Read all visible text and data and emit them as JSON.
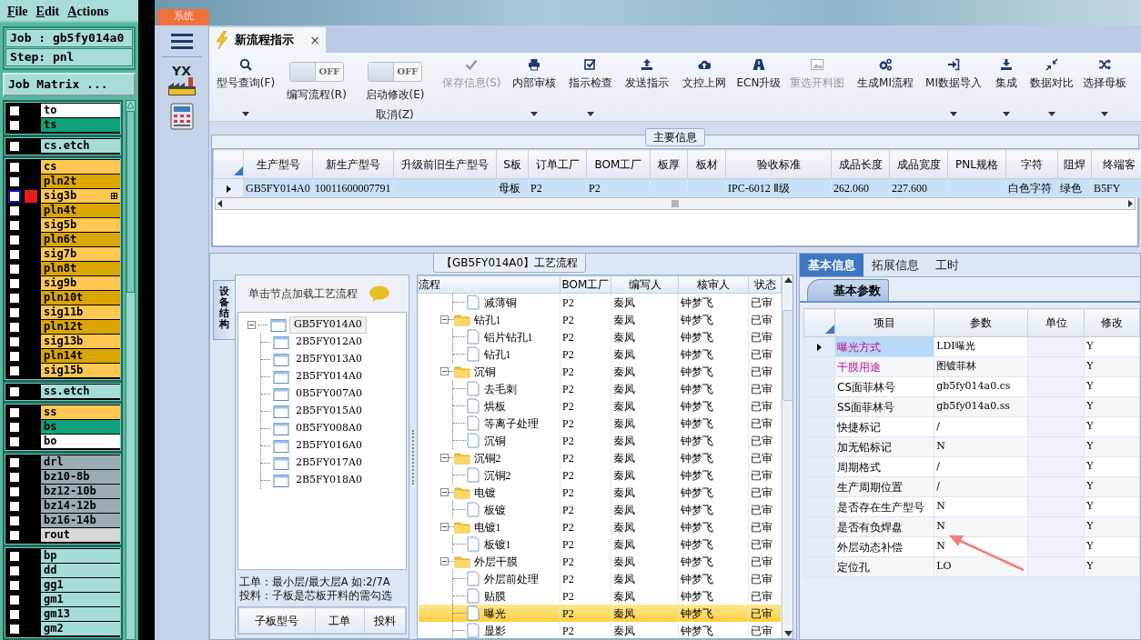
{
  "left_panel": {
    "menu": [
      "File",
      "Edit",
      "Actions"
    ],
    "job": "Job : gb5fy014a0",
    "step": "Step: pnl",
    "matrix_button": "Job Matrix ...",
    "layer_groups": [
      {
        "layers": [
          {
            "name": "to",
            "color": "#ffffff",
            "checked": false,
            "selected": false
          },
          {
            "name": "ts",
            "color": "#10a07a",
            "checked": false,
            "selected": false
          }
        ]
      },
      {
        "layers": [
          {
            "name": "cs.etch",
            "color": "#a6dcd8",
            "checked": false,
            "selected": false
          }
        ]
      },
      {
        "layers": [
          {
            "name": "cs",
            "color": "#ffc852",
            "checked": false,
            "selected": false
          },
          {
            "name": "pln2t",
            "color": "#dca600",
            "checked": false,
            "selected": false
          },
          {
            "name": "sig3b",
            "color": "#ffc852",
            "checked": false,
            "selected": true
          },
          {
            "name": "pln4t",
            "color": "#dca600",
            "checked": false,
            "selected": false
          },
          {
            "name": "sig5b",
            "color": "#ffc852",
            "checked": false,
            "selected": false
          },
          {
            "name": "pln6t",
            "color": "#dca600",
            "checked": false,
            "selected": false
          },
          {
            "name": "sig7b",
            "color": "#ffc852",
            "checked": false,
            "selected": false
          },
          {
            "name": "pln8t",
            "color": "#dca600",
            "checked": false,
            "selected": false
          },
          {
            "name": "sig9b",
            "color": "#ffc852",
            "checked": false,
            "selected": false
          },
          {
            "name": "pln10t",
            "color": "#dca600",
            "checked": false,
            "selected": false
          },
          {
            "name": "sig11b",
            "color": "#ffc852",
            "checked": false,
            "selected": false
          },
          {
            "name": "pln12t",
            "color": "#dca600",
            "checked": false,
            "selected": false
          },
          {
            "name": "sig13b",
            "color": "#ffc852",
            "checked": false,
            "selected": false
          },
          {
            "name": "pln14t",
            "color": "#dca600",
            "checked": false,
            "selected": false
          },
          {
            "name": "sig15b",
            "color": "#ffc852",
            "checked": false,
            "selected": false
          }
        ]
      },
      {
        "layers": [
          {
            "name": "ss.etch",
            "color": "#a6dcd8",
            "checked": false,
            "selected": false
          }
        ]
      },
      {
        "layers": [
          {
            "name": "ss",
            "color": "#ffc852",
            "checked": false,
            "selected": false
          },
          {
            "name": "bs",
            "color": "#10a07a",
            "checked": false,
            "selected": false
          },
          {
            "name": "bo",
            "color": "#ffffff",
            "checked": false,
            "selected": false
          }
        ]
      },
      {
        "layers": [
          {
            "name": "drl",
            "color": "#9aacb4",
            "checked": false,
            "selected": false
          },
          {
            "name": "bz10-8b",
            "color": "#9aacb4",
            "checked": false,
            "selected": false
          },
          {
            "name": "bz12-10b",
            "color": "#9aacb4",
            "checked": false,
            "selected": false
          },
          {
            "name": "bz14-12b",
            "color": "#9aacb4",
            "checked": false,
            "selected": false
          },
          {
            "name": "bz16-14b",
            "color": "#9aacb4",
            "checked": false,
            "selected": false
          },
          {
            "name": "rout",
            "color": "#d8d8d8",
            "checked": false,
            "selected": false
          }
        ]
      },
      {
        "layers": [
          {
            "name": "bp",
            "color": "#a6dcd8",
            "checked": false,
            "selected": false
          },
          {
            "name": "dd",
            "color": "#a6dcd8",
            "checked": false,
            "selected": false
          },
          {
            "name": "gg1",
            "color": "#a6dcd8",
            "checked": false,
            "selected": false
          },
          {
            "name": "gm1",
            "color": "#a6dcd8",
            "checked": false,
            "selected": false
          },
          {
            "name": "gm13",
            "color": "#a6dcd8",
            "checked": false,
            "selected": false
          },
          {
            "name": "gm2",
            "color": "#a6dcd8",
            "checked": false,
            "selected": false
          }
        ]
      }
    ]
  },
  "app": {
    "system_tab": "系统",
    "logo_text": "YX",
    "document_tab": {
      "title": "新流程指示",
      "close": "×"
    },
    "toolbar": [
      {
        "kind": "button",
        "label": "型号查询(F)",
        "dropdown": true,
        "disabled": false
      },
      {
        "kind": "toggle",
        "state_text": "OFF",
        "on": false,
        "label": "编写流程(R)"
      },
      {
        "kind": "toggle",
        "state_text": "OFF",
        "on": false,
        "label": "启动修改(E)",
        "label2": "取消(Z)"
      },
      {
        "kind": "button",
        "label": "保存信息(S)",
        "dropdown": false,
        "disabled": true
      },
      {
        "kind": "button",
        "label": "内部审核",
        "dropdown": true,
        "disabled": false
      },
      {
        "kind": "button",
        "label": "指示检查",
        "dropdown": true,
        "disabled": false
      },
      {
        "kind": "button",
        "label": "发送指示",
        "dropdown": false,
        "disabled": false
      },
      {
        "kind": "button",
        "label": "文控上网",
        "dropdown": false,
        "disabled": false
      },
      {
        "kind": "button",
        "label": "ECN升级",
        "dropdown": false,
        "disabled": false
      },
      {
        "kind": "button",
        "label": "重选开料图",
        "dropdown": false,
        "disabled": true
      },
      {
        "kind": "button",
        "label": "生成MI流程",
        "dropdown": false,
        "disabled": false
      },
      {
        "kind": "button",
        "label": "MI数据导入",
        "dropdown": true,
        "disabled": false
      },
      {
        "kind": "button",
        "label": "集成",
        "dropdown": true,
        "disabled": false
      },
      {
        "kind": "button",
        "label": "数据对比",
        "dropdown": true,
        "disabled": false
      },
      {
        "kind": "button",
        "label": "选择母板",
        "dropdown": true,
        "disabled": false
      }
    ],
    "main_info": {
      "title": "主要信息",
      "columns": [
        "生产型号",
        "新生产型号",
        "升级前旧生产型号",
        "S板",
        "订单工厂",
        "BOM工厂",
        "板厚",
        "板材",
        "验收标准",
        "成品长度",
        "成品宽度",
        "PNL规格",
        "字符",
        "阻焊",
        "终端客"
      ],
      "rows": [
        {
          "selected": true,
          "cells": [
            "GB5FY014A0",
            "10011600007791",
            null,
            "母板",
            "P2",
            "P2",
            null,
            null,
            "IPC-6012 Ⅱ级",
            "262.060",
            "227.600",
            null,
            "白色字符",
            "绿色",
            "B5FY"
          ]
        }
      ]
    },
    "process": {
      "title": "【GB5FY014A0】工艺流程",
      "side_tab": "设备结构",
      "hint": "单击节点加载工艺流程",
      "tree": {
        "label": "GB5FY014A0",
        "expanded": true,
        "selected": true,
        "children": [
          {
            "label": "2B5FY012A0",
            "selected": false
          },
          {
            "label": "2B5FY013A0",
            "selected": false
          },
          {
            "label": "2B5FY014A0",
            "selected": false
          },
          {
            "label": "0B5FY007A0",
            "selected": false
          },
          {
            "label": "2B5FY015A0",
            "selected": false
          },
          {
            "label": "0B5FY008A0",
            "selected": false
          },
          {
            "label": "2B5FY016A0",
            "selected": false
          },
          {
            "label": "2B5FY017A0",
            "selected": false
          },
          {
            "label": "2B5FY018A0",
            "selected": false
          }
        ]
      },
      "notes": [
        "工单：最小层/最大层A 如:2/7A",
        "投料：子板是芯板开料的需勾选"
      ],
      "sub_columns": [
        "子板型号",
        "工单",
        "投料"
      ],
      "flow_columns": [
        "流程",
        "BOM工厂",
        "编写人",
        "核审人",
        "状态"
      ],
      "flow": [
        {
          "kind": "step",
          "name": "减薄铜",
          "bom": "P2",
          "writer": "秦凤",
          "reviewer": "钟梦飞",
          "status": "已审",
          "selected": false
        },
        {
          "kind": "group",
          "name": "钻孔1",
          "expanded": true,
          "bom": "P2",
          "writer": "秦凤",
          "reviewer": "钟梦飞",
          "status": "已审",
          "selected": false,
          "children": [
            {
              "kind": "step",
              "name": "铝片钻孔1",
              "bom": "P2",
              "writer": "秦凤",
              "reviewer": "钟梦飞",
              "status": "已审",
              "selected": false
            },
            {
              "kind": "step",
              "name": "钻孔1",
              "bom": "P2",
              "writer": "秦凤",
              "reviewer": "钟梦飞",
              "status": "已审",
              "selected": false
            }
          ]
        },
        {
          "kind": "group",
          "name": "沉铜",
          "expanded": true,
          "bom": "P2",
          "writer": "秦凤",
          "reviewer": "钟梦飞",
          "status": "已审",
          "selected": false,
          "children": [
            {
              "kind": "step",
              "name": "去毛刺",
              "bom": "P2",
              "writer": "秦凤",
              "reviewer": "钟梦飞",
              "status": "已审",
              "selected": false
            },
            {
              "kind": "step",
              "name": "烘板",
              "bom": "P2",
              "writer": "秦凤",
              "reviewer": "钟梦飞",
              "status": "已审",
              "selected": false
            },
            {
              "kind": "step",
              "name": "等离子处理",
              "bom": "P2",
              "writer": "秦凤",
              "reviewer": "钟梦飞",
              "status": "已审",
              "selected": false
            },
            {
              "kind": "step",
              "name": "沉铜",
              "bom": "P2",
              "writer": "秦凤",
              "reviewer": "钟梦飞",
              "status": "已审",
              "selected": false
            }
          ]
        },
        {
          "kind": "group",
          "name": "沉铜2",
          "expanded": true,
          "bom": "P2",
          "writer": "秦凤",
          "reviewer": "钟梦飞",
          "status": "已审",
          "selected": false,
          "children": [
            {
              "kind": "step",
              "name": "沉铜2",
              "bom": "P2",
              "writer": "秦凤",
              "reviewer": "钟梦飞",
              "status": "已审",
              "selected": false
            }
          ]
        },
        {
          "kind": "group",
          "name": "电镀",
          "expanded": true,
          "bom": "P2",
          "writer": "秦凤",
          "reviewer": "钟梦飞",
          "status": "已审",
          "selected": false,
          "children": [
            {
              "kind": "step",
              "name": "板镀",
              "bom": "P2",
              "writer": "秦凤",
              "reviewer": "钟梦飞",
              "status": "已审",
              "selected": false
            }
          ]
        },
        {
          "kind": "group",
          "name": "电镀1",
          "expanded": true,
          "bom": "P2",
          "writer": "秦凤",
          "reviewer": "钟梦飞",
          "status": "已审",
          "selected": false,
          "children": [
            {
              "kind": "step",
              "name": "板镀1",
              "bom": "P2",
              "writer": "秦凤",
              "reviewer": "钟梦飞",
              "status": "已审",
              "selected": false
            }
          ]
        },
        {
          "kind": "group",
          "name": "外层干膜",
          "expanded": true,
          "bom": "P2",
          "writer": "秦凤",
          "reviewer": "钟梦飞",
          "status": "已审",
          "selected": false,
          "children": [
            {
              "kind": "step",
              "name": "外层前处理",
              "bom": "P2",
              "writer": "秦凤",
              "reviewer": "钟梦飞",
              "status": "已审",
              "selected": false
            },
            {
              "kind": "step",
              "name": "贴膜",
              "bom": "P2",
              "writer": "秦凤",
              "reviewer": "钟梦飞",
              "status": "已审",
              "selected": false
            },
            {
              "kind": "step",
              "name": "曝光",
              "bom": "P2",
              "writer": "秦凤",
              "reviewer": "钟梦飞",
              "status": "已审",
              "selected": true
            },
            {
              "kind": "step",
              "name": "显影",
              "bom": "P2",
              "writer": "秦凤",
              "reviewer": "钟梦飞",
              "status": "已审",
              "selected": false
            }
          ]
        }
      ]
    },
    "detail": {
      "tabs": [
        {
          "label": "基本信息",
          "selected": true
        },
        {
          "label": "拓展信息",
          "selected": false
        },
        {
          "label": "工时",
          "selected": false
        }
      ],
      "sub_tab": "基本参数",
      "columns": [
        "项目",
        "参数",
        "单位",
        "修改"
      ],
      "rows": [
        {
          "item": "曝光方式",
          "value": "LDI曝光",
          "modify": "Y",
          "highlighted": true,
          "selected": true
        },
        {
          "item": "干膜用途",
          "value": "图镀菲林",
          "modify": "Y",
          "highlighted": true,
          "selected": false
        },
        {
          "item": "CS面菲林号",
          "value": "gb5fy014a0.cs",
          "modify": "Y",
          "highlighted": false,
          "selected": false
        },
        {
          "item": "SS面菲林号",
          "value": "gb5fy014a0.ss",
          "modify": "Y",
          "highlighted": false,
          "selected": false
        },
        {
          "item": "快捷标记",
          "value": "/",
          "modify": "Y",
          "highlighted": false,
          "selected": false
        },
        {
          "item": "加无铅标记",
          "value": "N",
          "modify": "Y",
          "highlighted": false,
          "selected": false
        },
        {
          "item": "周期格式",
          "value": "/",
          "modify": "Y",
          "highlighted": false,
          "selected": false
        },
        {
          "item": "生产周期位置",
          "value": "/",
          "modify": "Y",
          "highlighted": false,
          "selected": false
        },
        {
          "item": "是否存在生产型号",
          "value": "N",
          "modify": "Y",
          "highlighted": false,
          "selected": false
        },
        {
          "item": "是否有负焊盘",
          "value": "N",
          "modify": "Y",
          "highlighted": false,
          "selected": false
        },
        {
          "item": "外层动态补偿",
          "value": "N",
          "modify": "Y",
          "highlighted": false,
          "selected": false
        },
        {
          "item": "定位孔",
          "value": "LO",
          "modify": "Y",
          "highlighted": false,
          "selected": false
        }
      ]
    }
  }
}
